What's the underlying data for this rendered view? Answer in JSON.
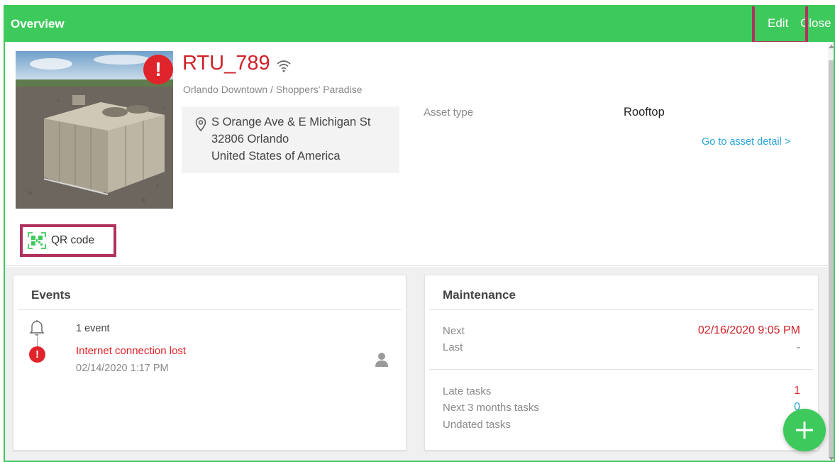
{
  "header": {
    "title": "Overview",
    "edit_label": "Edit",
    "close_label": "Close"
  },
  "asset": {
    "name": "RTU_789",
    "path": "Orlando Downtown / Shoppers' Paradise",
    "address": [
      "S Orange Ave & E Michigan St",
      "32806 Orlando",
      "United States of America"
    ],
    "type_label": "Asset type",
    "type_value": "Rooftop",
    "detail_link": "Go to asset detail >",
    "qr_label": "QR code",
    "alert_glyph": "!"
  },
  "events": {
    "title": "Events",
    "count": "1 event",
    "message": "Internet connection lost",
    "time": "02/14/2020 1:17 PM",
    "alert_glyph": "!"
  },
  "maintenance": {
    "title": "Maintenance",
    "next_label": "Next",
    "next_value": "02/16/2020 9:05 PM",
    "last_label": "Last",
    "last_value": "-",
    "late_label": "Late tasks",
    "late_value": "1",
    "three_months_label": "Next 3 months tasks",
    "three_months_value": "0",
    "undated_label": "Undated tasks"
  },
  "colors": {
    "brand": "#3ec95c",
    "alert": "#e0242b",
    "link": "#2ba5d6",
    "highlight": "#b0325d"
  },
  "icons": [
    "wifi-icon",
    "location-pin-icon",
    "qr-code-icon",
    "bell-icon",
    "alert-icon",
    "user-icon",
    "plus-icon"
  ]
}
